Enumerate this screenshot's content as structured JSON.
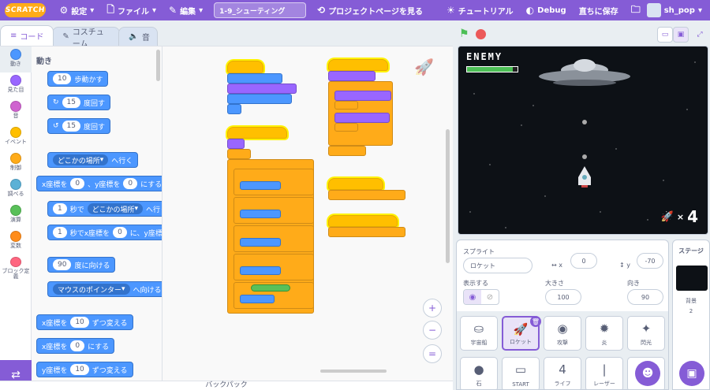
{
  "menubar": {
    "logo": "SCRATCH",
    "settings": "設定",
    "file": "ファイル",
    "edit": "編集",
    "project_title": "1-9_シューティング",
    "project_page": "プロジェクトページを見る",
    "tutorial": "チュートリアル",
    "debug": "Debug",
    "save_now": "直ちに保存",
    "username": "sh_pop"
  },
  "tabs": {
    "code": "コード",
    "costumes": "コスチューム",
    "sounds": "音"
  },
  "categories": [
    {
      "label": "動き",
      "color": "#4c97ff"
    },
    {
      "label": "見た目",
      "color": "#9966ff"
    },
    {
      "label": "音",
      "color": "#cf63cf"
    },
    {
      "label": "イベント",
      "color": "#ffbf00"
    },
    {
      "label": "制御",
      "color": "#ffab19"
    },
    {
      "label": "調べる",
      "color": "#5cb1d6"
    },
    {
      "label": "演算",
      "color": "#59c059"
    },
    {
      "label": "変数",
      "color": "#ff8c1a"
    },
    {
      "label": "ブロック定義",
      "color": "#ff6680"
    }
  ],
  "palette": {
    "heading": "動き",
    "move": {
      "value": "10",
      "text": "歩動かす"
    },
    "turn_right": {
      "value": "15",
      "text": "度回す"
    },
    "turn_left": {
      "value": "15",
      "text": "度回す"
    },
    "goto": {
      "dropdown": "どこかの場所",
      "text": "へ行く"
    },
    "gotoxy": {
      "t1": "x座標を",
      "x": "0",
      "t2": "、y座標を",
      "y": "0",
      "t3": "にする"
    },
    "glide": {
      "value": "1",
      "t1": "秒で",
      "dropdown": "どこかの場所",
      "t2": "へ行く"
    },
    "glidexy": {
      "value": "1",
      "t1": "秒でx座標を",
      "x": "0",
      "t2": "に、y座標を"
    },
    "point_dir": {
      "value": "90",
      "text": "度に向ける"
    },
    "point_towards": {
      "dropdown": "マウスのポインター",
      "text": "へ向ける"
    },
    "change_x": {
      "t1": "x座標を",
      "value": "10",
      "t2": "ずつ変える"
    },
    "set_x": {
      "t1": "x座標を",
      "value": "0",
      "t2": "にする"
    },
    "change_y": {
      "t1": "y座標を",
      "value": "10",
      "t2": "ずつ変える"
    }
  },
  "backpack": "バックパック",
  "stage": {
    "enemy_label": "ENEMY",
    "lives": "4",
    "lives_x": "×",
    "hp": 0.9
  },
  "sprite_info": {
    "sprite_label": "スプライト",
    "sprite_name": "ロケット",
    "x_label": "x",
    "x": "0",
    "y_label": "y",
    "y": "-70",
    "show_label": "表示する",
    "size_label": "大きさ",
    "size": "100",
    "dir_label": "向き",
    "dir": "90"
  },
  "sprites": [
    {
      "name": "宇宙船",
      "icon": "⛀"
    },
    {
      "name": "ロケット",
      "icon": "🚀"
    },
    {
      "name": "攻撃",
      "icon": "◉"
    },
    {
      "name": "炎",
      "icon": "✹"
    },
    {
      "name": "閃光",
      "icon": "✦"
    },
    {
      "name": "石",
      "icon": "●"
    },
    {
      "name": "START",
      "icon": "▭"
    },
    {
      "name": "ライフ",
      "icon": "4"
    },
    {
      "name": "レーザー",
      "icon": "|"
    },
    {
      "name": "",
      "icon": "▬"
    }
  ],
  "stage_pane": {
    "title": "ステージ",
    "backdrop_label": "背景",
    "backdrop_count": "2"
  }
}
